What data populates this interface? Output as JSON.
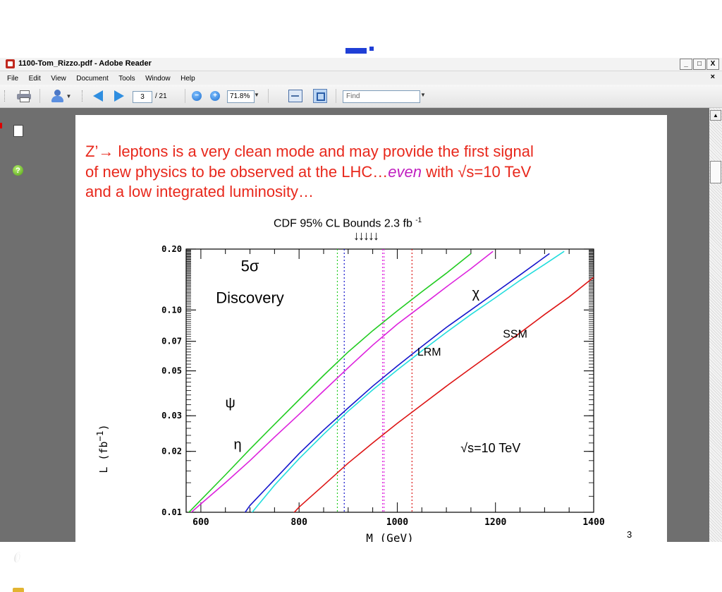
{
  "window": {
    "title": "1100-Tom_Rizzo.pdf - Adobe Reader",
    "buttons": {
      "minimize": "_",
      "maximize": "□",
      "close": "X"
    }
  },
  "menu": {
    "items": [
      "File",
      "Edit",
      "View",
      "Document",
      "Tools",
      "Window",
      "Help"
    ],
    "doc_close": "×"
  },
  "toolbar": {
    "current_page": "3",
    "total_pages": "/ 21",
    "zoom": "71.8%",
    "find_placeholder": "Find"
  },
  "slide": {
    "text_line1": "Z’→ leptons is a very clean mode and may provide the first signal",
    "text_line2_a": "of new physics to be observed at the LHC…",
    "text_line2_em": "even",
    "text_line2_b": " with √s=10 TeV",
    "text_line3": "and a low integrated luminosity…",
    "cdf_label": "CDF  95% CL Bounds 2.3 fb ",
    "cdf_label_sup": "-1",
    "arrows": "↓↓↓↓↓",
    "page_number": "3"
  },
  "chart_data": {
    "type": "line",
    "title": "5σ Discovery",
    "annotation": "√s=10 TeV",
    "ylabel": "L (fb",
    "ylabel_sup": "−1",
    "ylabel_close": ")",
    "xlabel": "M (GeV)",
    "xlim": [
      570,
      1400
    ],
    "ylim": [
      0.01,
      0.2
    ],
    "yscale": "log",
    "x_ticks": [
      600,
      800,
      1000,
      1200,
      1400
    ],
    "y_tick_labels": [
      {
        "value": 0.01,
        "label": "0.01"
      },
      {
        "value": 0.02,
        "label": "0.02"
      },
      {
        "value": 0.03,
        "label": "0.03"
      },
      {
        "value": 0.05,
        "label": "0.05"
      },
      {
        "value": 0.07,
        "label": "0.07"
      },
      {
        "value": 0.1,
        "label": "0.10"
      },
      {
        "value": 0.2,
        "label": "0.20"
      }
    ],
    "series": [
      {
        "name": "ψ",
        "color": "#22cc22",
        "label_at": [
          660,
          0.033
        ],
        "x": [
          565,
          600,
          650,
          700,
          750,
          800,
          850,
          900,
          950,
          1000,
          1050,
          1100,
          1150
        ],
        "y": [
          0.0094,
          0.0115,
          0.0153,
          0.0205,
          0.0272,
          0.036,
          0.0475,
          0.062,
          0.079,
          0.099,
          0.123,
          0.152,
          0.19
        ]
      },
      {
        "name": "η",
        "color": "#dd22dd",
        "label_at": [
          675,
          0.0205
        ],
        "x": [
          570,
          600,
          650,
          700,
          750,
          800,
          850,
          900,
          950,
          1000,
          1050,
          1100,
          1150,
          1195
        ],
        "y": [
          0.0095,
          0.011,
          0.014,
          0.018,
          0.0235,
          0.0305,
          0.0398,
          0.0518,
          0.067,
          0.085,
          0.105,
          0.13,
          0.16,
          0.195
        ]
      },
      {
        "name": "χ",
        "color": "#1515cc",
        "label_at": [
          1160,
          0.115
        ],
        "x": [
          685,
          700,
          750,
          800,
          850,
          900,
          950,
          1000,
          1050,
          1100,
          1150,
          1200,
          1250,
          1310
        ],
        "y": [
          0.0096,
          0.0108,
          0.0145,
          0.0195,
          0.0255,
          0.0328,
          0.042,
          0.0528,
          0.066,
          0.082,
          0.1,
          0.122,
          0.149,
          0.19
        ]
      },
      {
        "name": "LRM",
        "color": "#22dddd",
        "label_at": [
          1065,
          0.0595
        ],
        "x": [
          700,
          750,
          800,
          850,
          900,
          950,
          1000,
          1050,
          1100,
          1150,
          1200,
          1250,
          1300,
          1340
        ],
        "y": [
          0.0097,
          0.0136,
          0.0184,
          0.0243,
          0.0316,
          0.0403,
          0.0505,
          0.0628,
          0.0775,
          0.095,
          0.115,
          0.14,
          0.168,
          0.195
        ]
      },
      {
        "name": "SSM",
        "color": "#dd1515",
        "label_at": [
          1240,
          0.073
        ],
        "x": [
          780,
          800,
          850,
          900,
          950,
          1000,
          1050,
          1100,
          1150,
          1200,
          1250,
          1300,
          1350,
          1400
        ],
        "y": [
          0.0094,
          0.0106,
          0.0136,
          0.0175,
          0.022,
          0.0275,
          0.034,
          0.042,
          0.0515,
          0.063,
          0.077,
          0.095,
          0.116,
          0.145
        ]
      }
    ],
    "cdf_bounds": [
      {
        "x": 878,
        "color": "#22cc22"
      },
      {
        "x": 892,
        "color": "#1515cc"
      },
      {
        "x": 970,
        "color": "#dd22dd"
      },
      {
        "x": 973,
        "color": "#dd22dd"
      },
      {
        "x": 1030,
        "color": "#dd1515"
      }
    ]
  }
}
